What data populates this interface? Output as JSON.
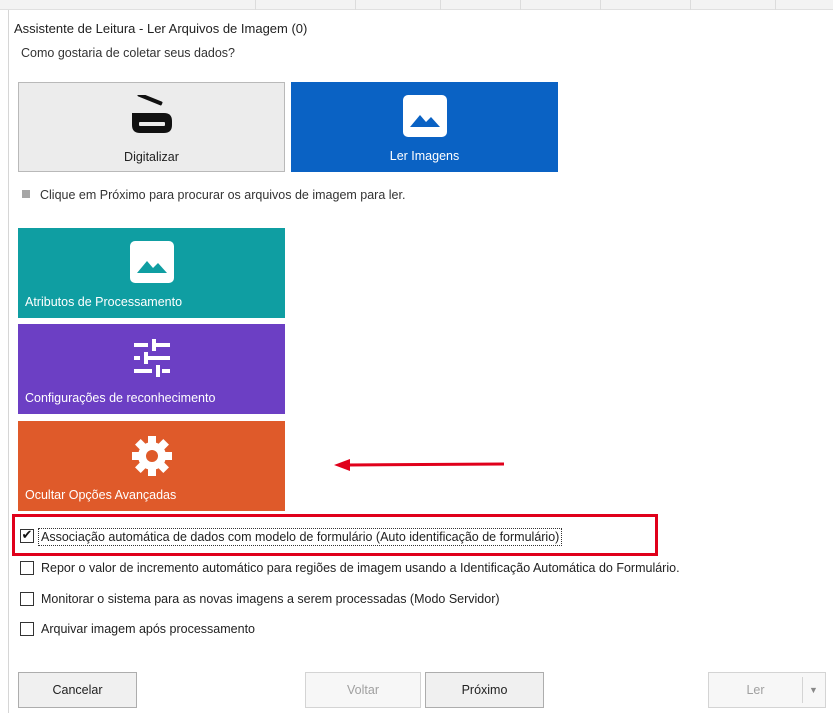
{
  "window": {
    "title": "Assistente de Leitura - Ler Arquivos de Imagem (0)"
  },
  "question": "Como gostaria de coletar seus dados?",
  "modes": [
    {
      "label": "Digitalizar",
      "icon": "scanner-icon",
      "selected": false
    },
    {
      "label": "Ler Imagens",
      "icon": "image-icon",
      "selected": true,
      "color": "#0a62c4"
    }
  ],
  "hint": "Clique em Próximo para procurar os arquivos de imagem para ler.",
  "option_tiles": [
    {
      "label": "Atributos de Processamento",
      "icon": "image-icon",
      "color": "#0f9ea2"
    },
    {
      "label": "Configurações de reconhecimento",
      "icon": "sliders-icon",
      "color": "#6c3fc4"
    },
    {
      "label": "Ocultar Opções Avançadas",
      "icon": "gear-icon",
      "color": "#df5a2a"
    }
  ],
  "annotations": {
    "arrow_color": "#e0001b",
    "highlight_color": "#e0001b"
  },
  "checkboxes": [
    {
      "label": "Associação automática de dados com modelo de formulário (Auto identificação de formulário)",
      "checked": true
    },
    {
      "label": "Repor o valor de incremento automático para regiões de imagem usando a Identificação Automática do Formulário.",
      "checked": false
    },
    {
      "label": "Monitorar o sistema para as novas imagens a serem processadas (Modo Servidor)",
      "checked": false
    },
    {
      "label": "Arquivar imagem após processamento",
      "checked": false
    }
  ],
  "buttons": {
    "cancel": "Cancelar",
    "back": "Voltar",
    "next": "Próximo",
    "read": "Ler"
  }
}
